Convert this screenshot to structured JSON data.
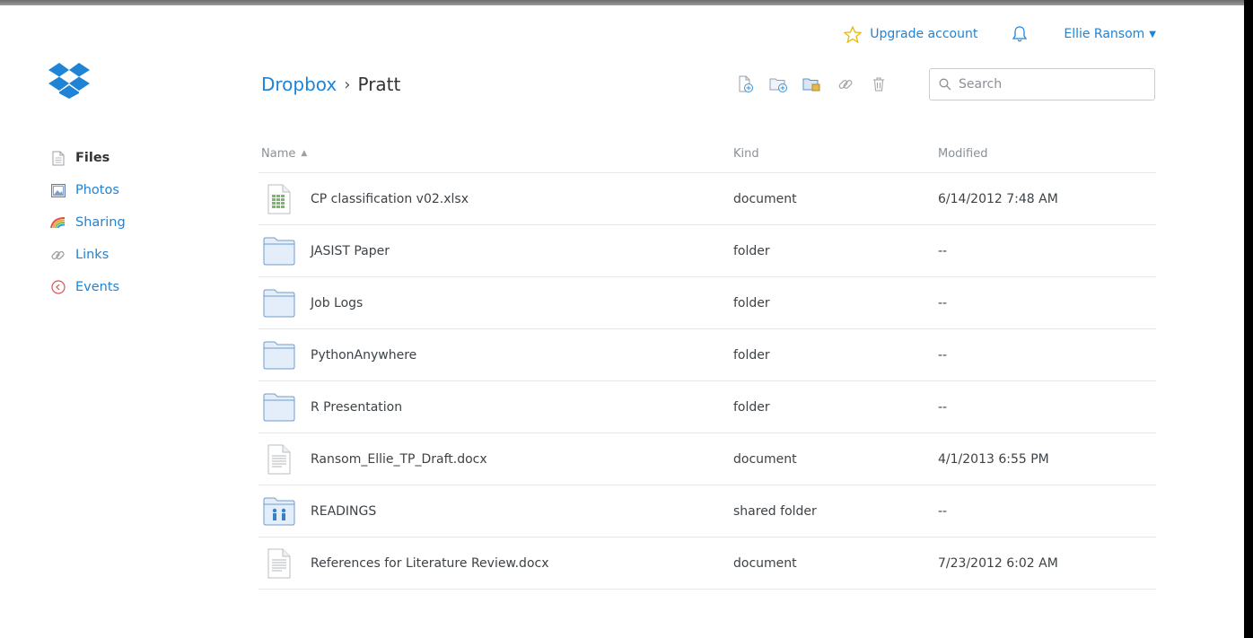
{
  "account": {
    "upgrade_label": "Upgrade account",
    "user_name": "Ellie Ransom"
  },
  "sidebar": {
    "items": [
      {
        "label": "Files",
        "icon": "file-icon",
        "active": true
      },
      {
        "label": "Photos",
        "icon": "photo-icon",
        "active": false
      },
      {
        "label": "Sharing",
        "icon": "rainbow-icon",
        "active": false
      },
      {
        "label": "Links",
        "icon": "link-icon",
        "active": false
      },
      {
        "label": "Events",
        "icon": "clock-icon",
        "active": false
      }
    ]
  },
  "breadcrumb": {
    "root": "Dropbox",
    "separator": "›",
    "current": "Pratt"
  },
  "toolbar": {
    "icons": [
      "upload-file-icon",
      "new-folder-icon",
      "new-shared-folder-icon",
      "share-link-icon",
      "delete-icon"
    ]
  },
  "search": {
    "placeholder": "Search",
    "value": ""
  },
  "table": {
    "headers": {
      "name": "Name",
      "kind": "Kind",
      "modified": "Modified"
    },
    "sort": "name-ascending",
    "rows": [
      {
        "name": "CP classification v02.xlsx",
        "kind": "document",
        "modified": "6/14/2012 7:48 AM",
        "icon": "spreadsheet-icon"
      },
      {
        "name": "JASIST Paper",
        "kind": "folder",
        "modified": "--",
        "icon": "folder-icon"
      },
      {
        "name": "Job Logs",
        "kind": "folder",
        "modified": "--",
        "icon": "folder-icon"
      },
      {
        "name": "PythonAnywhere",
        "kind": "folder",
        "modified": "--",
        "icon": "folder-icon"
      },
      {
        "name": "R Presentation",
        "kind": "folder",
        "modified": "--",
        "icon": "folder-icon"
      },
      {
        "name": "Ransom_Ellie_TP_Draft.docx",
        "kind": "document",
        "modified": "4/1/2013 6:55 PM",
        "icon": "document-icon"
      },
      {
        "name": "READINGS",
        "kind": "shared folder",
        "modified": "--",
        "icon": "shared-folder-icon"
      },
      {
        "name": "References for Literature Review.docx",
        "kind": "document",
        "modified": "7/23/2012 6:02 AM",
        "icon": "document-icon"
      }
    ]
  },
  "colors": {
    "accent": "#1f83d6",
    "star": "#e6b800",
    "text": "#3d4246",
    "muted": "#8b9095",
    "divider": "#e6e8ea"
  }
}
